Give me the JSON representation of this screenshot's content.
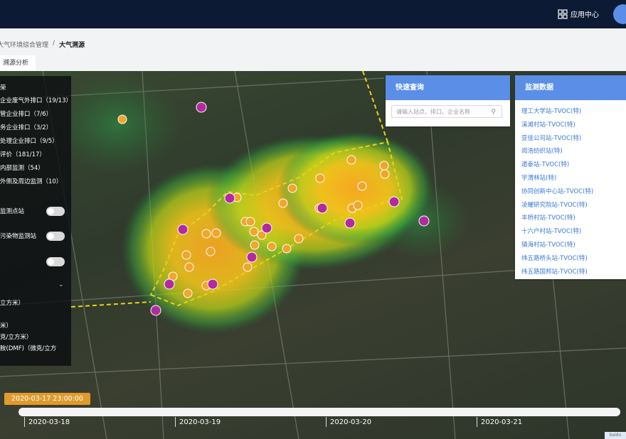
{
  "header": {
    "app_center_label": "应用中心",
    "app_center_icon": "grid-icon"
  },
  "breadcrumb": {
    "parent": "大气环境综合管理",
    "separator": "/",
    "current": "大气溯源"
  },
  "tabs": [
    {
      "label": "溯源分析"
    }
  ],
  "left_panel": {
    "group_title": "荣",
    "layers": [
      {
        "label": "企业废气外排口（19/13）"
      },
      {
        "label": "管企业排口（7/6）"
      },
      {
        "label": "务企业排口（3/2）"
      },
      {
        "label": "处理企业排口（9/5）"
      },
      {
        "label": "评价（181/17）"
      },
      {
        "label": "内部监测（54）"
      },
      {
        "label": "外侧及周边监测（10）"
      }
    ],
    "toggles": [
      {
        "label": "监测点站",
        "on": false
      },
      {
        "label": "污染物监测站",
        "on": false
      },
      {
        "label": "",
        "on": false
      }
    ],
    "unit_label": "立方米）",
    "units": [
      {
        "label": "米）"
      },
      {
        "label": "克/立方米）"
      },
      {
        "label": "胺(DMF)（微克/立方"
      }
    ]
  },
  "quick_query": {
    "title": "快速查询",
    "placeholder": "请输入站点、排口、企业名称",
    "search_icon": "search-icon"
  },
  "monitor": {
    "title": "监测数据",
    "items": [
      "理工大学站-TVOC(特)",
      "溪滩村站-TVOC(特)",
      "亚佳公司站-TVOC(特)",
      "阅浩纺织站(特)",
      "遁泰站-TVOC(特)",
      "宇渭林站(特)",
      "协同创新中心站-TVOC(特)",
      "凌耀研究院站-TVOC(特)",
      "丰桥村站-TVOC(特)",
      "十六户村站-TVOC(特)",
      "镇海村站-TVOC(特)",
      "纬五路桥头站-TVOC(特)",
      "纬五路国邦站-TVOC(特)"
    ]
  },
  "timeline": {
    "current": "2020-03-17 23:00:00",
    "dates": [
      "2020-03-18",
      "2020-03-19",
      "2020-03-20",
      "2020-03-21"
    ]
  },
  "map_attribution": "baidu",
  "colors": {
    "accent": "#5b8ee6",
    "topbar": "#0c1a33",
    "time_badge": "#e19a2c",
    "marker_source": "#f0a52b",
    "marker_station": "#b32aa0",
    "boundary": "#e8d21a"
  }
}
